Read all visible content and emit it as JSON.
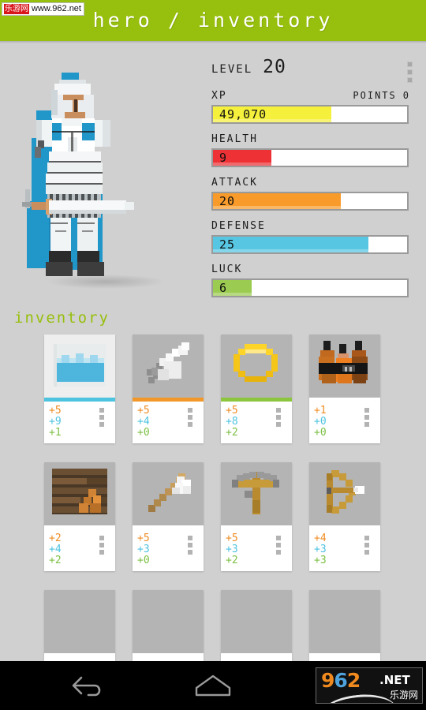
{
  "watermark": {
    "top_cn": "乐游网",
    "top_url": "www.962.net",
    "nav_logo_9": "9",
    "nav_logo_6": "6",
    "nav_logo_2": "2",
    "nav_logo_net": ".NET",
    "nav_logo_cn": "乐游网"
  },
  "header": {
    "title": "hero / inventory",
    "accent_color": "#97bf0d",
    "overflow_icon": "kebab-menu-icon"
  },
  "hero": {
    "sprite_name": "knight-pixel-sprite",
    "armor_color": "#f2f2f2",
    "cape_color": "#2196c9",
    "skin_color": "#c98e5e",
    "boot_color": "#3a3a3a"
  },
  "stats": {
    "level_label": "LEVEL",
    "level_value": "20",
    "points_label": "POINTS",
    "points_value": "0",
    "bars": [
      {
        "label": "XP",
        "value": "49,070",
        "percent": 61,
        "color": "#f5f03c"
      },
      {
        "label": "HEALTH",
        "value": "9",
        "percent": 30,
        "color": "#ee3135"
      },
      {
        "label": "ATTACK",
        "value": "20",
        "percent": 66,
        "color": "#f89b2a"
      },
      {
        "label": "DEFENSE",
        "value": "25",
        "percent": 80,
        "color": "#56c6e3"
      },
      {
        "label": "LUCK",
        "value": "6",
        "percent": 20,
        "color": "#9ccb51"
      }
    ]
  },
  "inventory": {
    "title": "inventory",
    "stat_colors": {
      "attack": "#ef8c23",
      "defense": "#4ec3e0",
      "luck": "#7cc043"
    },
    "items": [
      {
        "icon": "shield-item-icon",
        "attack": "+5",
        "defense": "+9",
        "luck": "+1",
        "accent": "#4ec3e0",
        "equipped": true
      },
      {
        "icon": "sword-item-icon",
        "attack": "+5",
        "defense": "+4",
        "luck": "+0",
        "accent": "#f2982b",
        "equipped": false
      },
      {
        "icon": "ring-item-icon",
        "attack": "+5",
        "defense": "+8",
        "luck": "+2",
        "accent": "#8cc63f",
        "equipped": false
      },
      {
        "icon": "potions-item-icon",
        "attack": "+1",
        "defense": "+0",
        "luck": "+0",
        "accent": "",
        "equipped": false
      },
      {
        "icon": "wood-shield-item-icon",
        "attack": "+2",
        "defense": "+4",
        "luck": "+2",
        "accent": "",
        "equipped": false
      },
      {
        "icon": "axe-item-icon",
        "attack": "+5",
        "defense": "+3",
        "luck": "+0",
        "accent": "",
        "equipped": false
      },
      {
        "icon": "crossbow-item-icon",
        "attack": "+5",
        "defense": "+3",
        "luck": "+2",
        "accent": "",
        "equipped": false
      },
      {
        "icon": "bow-item-icon",
        "attack": "+4",
        "defense": "+3",
        "luck": "+3",
        "accent": "",
        "equipped": false
      },
      {
        "icon": "empty-slot-icon",
        "attack": "",
        "defense": "",
        "luck": "",
        "accent": "",
        "equipped": false
      },
      {
        "icon": "empty-slot-icon",
        "attack": "",
        "defense": "",
        "luck": "",
        "accent": "",
        "equipped": false
      },
      {
        "icon": "empty-slot-icon",
        "attack": "",
        "defense": "",
        "luck": "",
        "accent": "",
        "equipped": false
      },
      {
        "icon": "empty-slot-icon",
        "attack": "",
        "defense": "",
        "luck": "",
        "accent": "",
        "equipped": false
      }
    ]
  },
  "navbar": {
    "back_icon": "back-arrow-icon",
    "home_icon": "home-icon"
  }
}
